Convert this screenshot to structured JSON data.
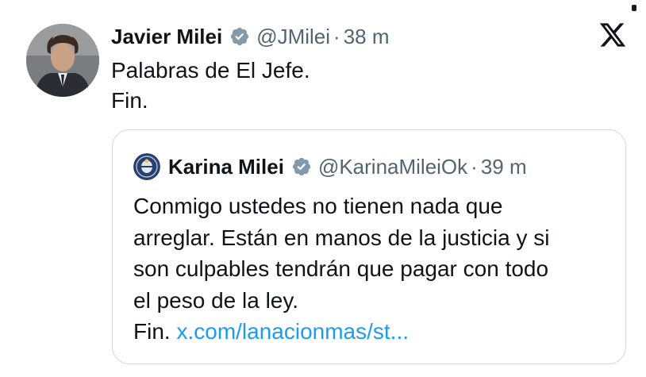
{
  "tweet": {
    "author_name": "Javier Milei",
    "handle": "@JMilei",
    "separator": "·",
    "time": "38 m",
    "lines": [
      "Palabras de El Jefe.",
      "Fin."
    ]
  },
  "quoted_tweet": {
    "author_name": "Karina Milei",
    "handle": "@KarinaMileiOk",
    "separator": "·",
    "time": "39 m",
    "lines": [
      "Conmigo ustedes no tienen nada que",
      "arreglar. Están en manos de la justicia y si",
      "son culpables tendrán que pagar con todo",
      "el peso de la ley."
    ],
    "last_line_prefix": "Fin.",
    "link_text": "x.com/lanacionmas/st..."
  },
  "icons": {
    "verified_badge": "verified-badge-icon",
    "platform_logo": "x-logo-icon"
  },
  "colors": {
    "text_primary": "#0f1419",
    "text_secondary": "#536471",
    "link": "#1d9bf0",
    "border": "#cfd9de",
    "badge": "#829aab"
  }
}
